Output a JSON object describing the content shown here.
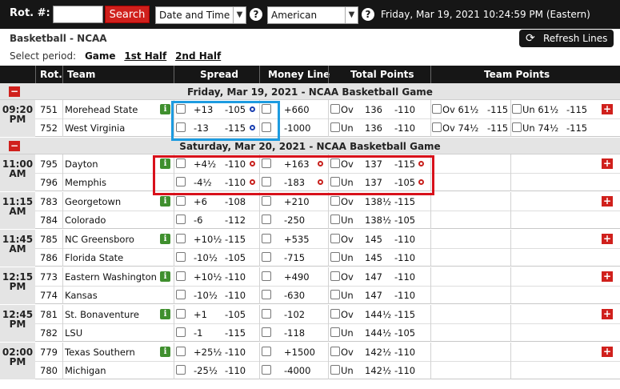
{
  "topbar": {
    "rot_label": "Rot. #:",
    "rot_value": "",
    "search_label": "Search",
    "sort_select": "Date and Time",
    "odds_select": "American",
    "help_icon": "?",
    "datetime": "Friday, Mar 19, 2021 10:24:59 PM (Eastern)"
  },
  "subheader": {
    "title": "Basketball - NCAA",
    "refresh_label": "Refresh Lines",
    "period_label": "Select period:",
    "periods": [
      "Game",
      "1st Half",
      "2nd Half"
    ],
    "active_period": "Game"
  },
  "table": {
    "headers": [
      "Rot.",
      "Team",
      "Spread",
      "Money Line",
      "Total Points",
      "Team Points"
    ],
    "sections": [
      {
        "title": "Friday, Mar 19, 2021 - NCAA Basketball Game",
        "games": [
          {
            "time": [
              "09:20",
              "PM"
            ],
            "rows": [
              {
                "rot": "751",
                "team": "Morehead State",
                "spread": "+13",
                "spread_odds": "-105",
                "ml": "+660",
                "tp_side": "Ov",
                "tp_line": "136",
                "tp_odds": "-110",
                "tm1": "Ov 61½",
                "tm1_odds": "-115",
                "tm2": "Un 61½",
                "tm2_odds": "-115"
              },
              {
                "rot": "752",
                "team": "West Virginia",
                "spread": "-13",
                "spread_odds": "-115",
                "ml": "-1000",
                "tp_side": "Un",
                "tp_line": "136",
                "tp_odds": "-110",
                "tm1": "Ov 74½",
                "tm1_odds": "-115",
                "tm2": "Un 74½",
                "tm2_odds": "-115"
              }
            ]
          }
        ]
      },
      {
        "title": "Saturday, Mar 20, 2021 - NCAA Basketball Game",
        "games": [
          {
            "time": [
              "11:00",
              "AM"
            ],
            "rows": [
              {
                "rot": "795",
                "team": "Dayton",
                "spread": "+4½",
                "spread_odds": "-110",
                "ml": "+163",
                "tp_side": "Ov",
                "tp_line": "137",
                "tp_odds": "-115"
              },
              {
                "rot": "796",
                "team": "Memphis",
                "spread": "-4½",
                "spread_odds": "-110",
                "ml": "-183",
                "tp_side": "Un",
                "tp_line": "137",
                "tp_odds": "-105"
              }
            ]
          },
          {
            "time": [
              "11:15",
              "AM"
            ],
            "rows": [
              {
                "rot": "783",
                "team": "Georgetown",
                "spread": "+6",
                "spread_odds": "-108",
                "ml": "+210",
                "tp_side": "Ov",
                "tp_line": "138½",
                "tp_odds": "-115"
              },
              {
                "rot": "784",
                "team": "Colorado",
                "spread": "-6",
                "spread_odds": "-112",
                "ml": "-250",
                "tp_side": "Un",
                "tp_line": "138½",
                "tp_odds": "-105"
              }
            ]
          },
          {
            "time": [
              "11:45",
              "AM"
            ],
            "rows": [
              {
                "rot": "785",
                "team": "NC Greensboro",
                "spread": "+10½",
                "spread_odds": "-115",
                "ml": "+535",
                "tp_side": "Ov",
                "tp_line": "145",
                "tp_odds": "-110"
              },
              {
                "rot": "786",
                "team": "Florida State",
                "spread": "-10½",
                "spread_odds": "-105",
                "ml": "-715",
                "tp_side": "Un",
                "tp_line": "145",
                "tp_odds": "-110"
              }
            ]
          },
          {
            "time": [
              "12:15",
              "PM"
            ],
            "rows": [
              {
                "rot": "773",
                "team": "Eastern Washington",
                "spread": "+10½",
                "spread_odds": "-110",
                "ml": "+490",
                "tp_side": "Ov",
                "tp_line": "147",
                "tp_odds": "-110"
              },
              {
                "rot": "774",
                "team": "Kansas",
                "spread": "-10½",
                "spread_odds": "-110",
                "ml": "-630",
                "tp_side": "Un",
                "tp_line": "147",
                "tp_odds": "-110"
              }
            ]
          },
          {
            "time": [
              "12:45",
              "PM"
            ],
            "rows": [
              {
                "rot": "781",
                "team": "St. Bonaventure",
                "spread": "+1",
                "spread_odds": "-105",
                "ml": "-102",
                "tp_side": "Ov",
                "tp_line": "144½",
                "tp_odds": "-115"
              },
              {
                "rot": "782",
                "team": "LSU",
                "spread": "-1",
                "spread_odds": "-115",
                "ml": "-118",
                "tp_side": "Un",
                "tp_line": "144½",
                "tp_odds": "-105"
              }
            ]
          },
          {
            "time": [
              "02:00",
              "PM"
            ],
            "rows": [
              {
                "rot": "779",
                "team": "Texas Southern",
                "spread": "+25½",
                "spread_odds": "-110",
                "ml": "+1500",
                "tp_side": "Ov",
                "tp_line": "142½",
                "tp_odds": "-110"
              },
              {
                "rot": "780",
                "team": "Michigan",
                "spread": "-25½",
                "spread_odds": "-110",
                "ml": "-4000",
                "tp_side": "Un",
                "tp_line": "142½",
                "tp_odds": "-110"
              }
            ]
          }
        ]
      }
    ]
  },
  "colors": {
    "accent_red": "#d0201c",
    "bar_black": "#161616",
    "info_green": "#3f8f2e",
    "highlight_blue": "#1d9be0",
    "highlight_red": "#d8111b"
  }
}
